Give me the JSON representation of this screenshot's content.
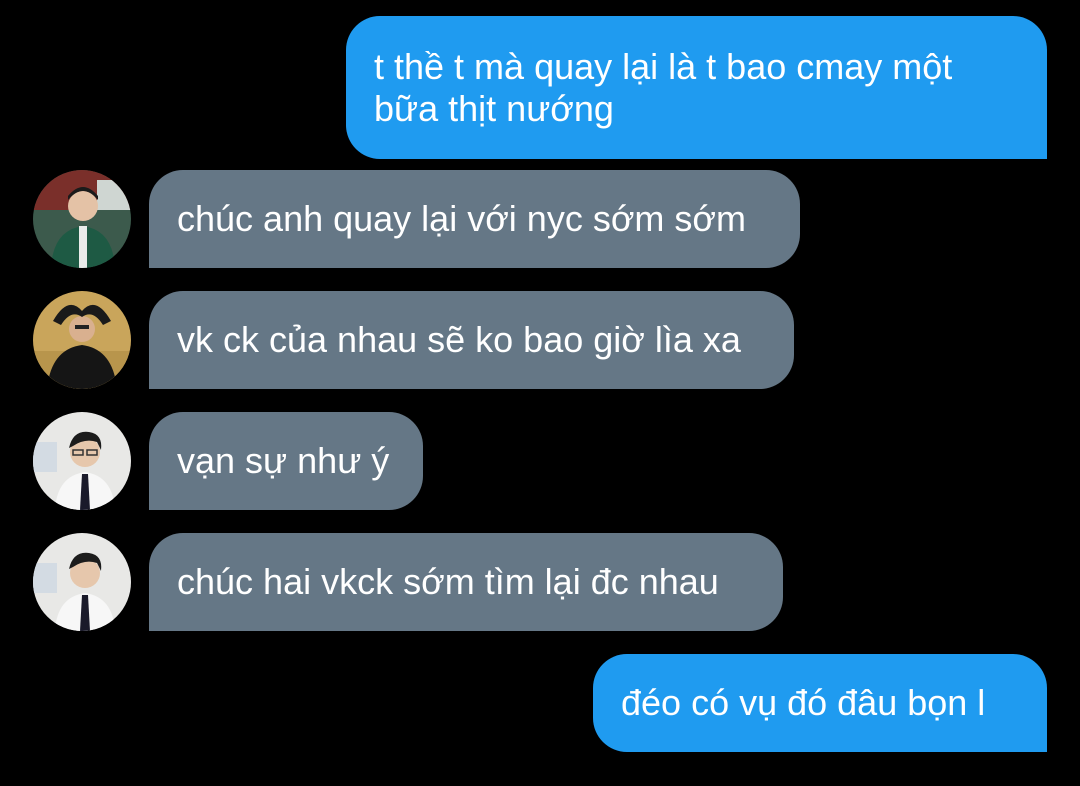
{
  "conversation": {
    "messages": [
      {
        "direction": "outgoing",
        "text": "t thề t mà quay lại là t bao cmay một bữa thịt nướng"
      },
      {
        "direction": "incoming",
        "avatar": "user-avatar-green-jacket",
        "text": "chúc anh quay lại với nyc sớm sớm"
      },
      {
        "direction": "incoming",
        "avatar": "user-avatar-hands-on-head",
        "text": "vk ck của nhau sẽ ko bao giờ lìa xa"
      },
      {
        "direction": "incoming",
        "avatar": "user-avatar-white-shirt-tie",
        "text": "vạn sự như ý"
      },
      {
        "direction": "incoming",
        "avatar": "user-avatar-white-shirt-tie",
        "text": "chúc hai vkck sớm tìm lại đc nhau"
      },
      {
        "direction": "outgoing",
        "text": "đéo có vụ đó đâu bọn l"
      }
    ]
  },
  "colors": {
    "background": "#000000",
    "outgoing_bubble": "#1f9bf0",
    "incoming_bubble": "#657786",
    "text": "#ffffff"
  }
}
